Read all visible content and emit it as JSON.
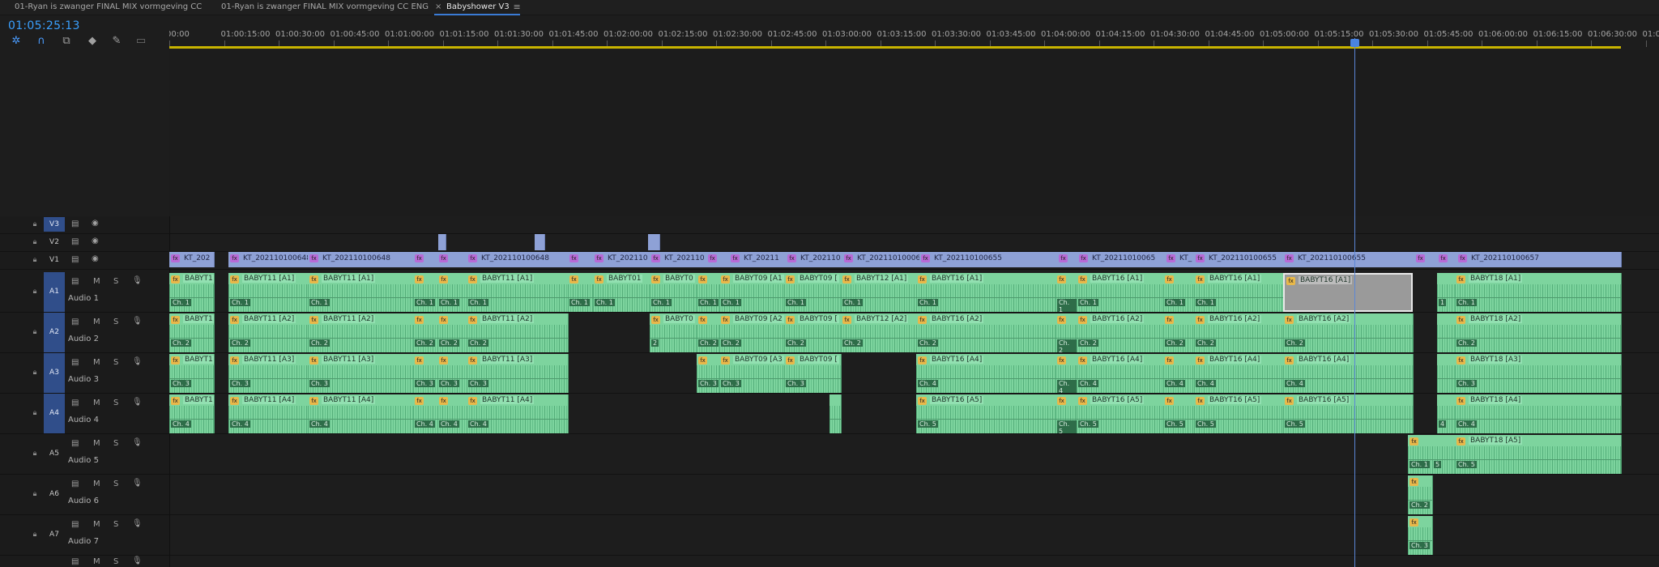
{
  "tabs": [
    {
      "label": "01-Ryan is zwanger FINAL MIX vormgeving CC",
      "active": false
    },
    {
      "label": "01-Ryan is zwanger FINAL MIX vormgeving CC ENG",
      "active": false
    },
    {
      "label": "Babyshower V3",
      "active": true,
      "close": "×",
      "menu": "≡"
    }
  ],
  "timecode": "01:05:25:13",
  "toolbar_icons": [
    "snap-icon",
    "magnet-icon",
    "linked-selection-icon",
    "marker-icon",
    "wrench-icon",
    "captions-icon"
  ],
  "ruler_labels": [
    "00:00",
    "01:00:15:00",
    "01:00:30:00",
    "01:00:45:00",
    "01:01:00:00",
    "01:01:15:00",
    "01:01:30:00",
    "01:01:45:00",
    "01:02:00:00",
    "01:02:15:00",
    "01:02:30:00",
    "01:02:45:00",
    "01:03:00:00",
    "01:03:15:00",
    "01:03:30:00",
    "01:03:45:00",
    "01:04:00:00",
    "01:04:15:00",
    "01:04:30:00",
    "01:04:45:00",
    "01:05:00:00",
    "01:05:15:00",
    "01:05:30:00",
    "01:05:45:00",
    "01:06:00:00",
    "01:06:15:00",
    "01:06:30:00",
    "01:06:45:00"
  ],
  "video_tracks": [
    {
      "label": "V3",
      "highlight": true
    },
    {
      "label": "V2",
      "highlight": false
    },
    {
      "label": "V1",
      "highlight": false
    }
  ],
  "audio_tracks": [
    {
      "label": "A1",
      "name": "Audio 1",
      "highlight": true,
      "m": "M",
      "s": "S"
    },
    {
      "label": "A2",
      "name": "Audio 2",
      "highlight": true,
      "m": "M",
      "s": "S"
    },
    {
      "label": "A3",
      "name": "Audio 3",
      "highlight": true,
      "m": "M",
      "s": "S"
    },
    {
      "label": "A4",
      "name": "Audio 4",
      "highlight": true,
      "m": "M",
      "s": "S"
    },
    {
      "label": "A5",
      "name": "Audio 5",
      "highlight": false,
      "m": "M",
      "s": "S"
    },
    {
      "label": "A6",
      "name": "Audio 6",
      "highlight": false,
      "m": "M",
      "s": "S"
    },
    {
      "label": "A7",
      "name": "Audio 7",
      "highlight": false,
      "m": "M",
      "s": "S"
    }
  ],
  "v1_clip_names": [
    "KT_202",
    "KT_202110100648",
    "KT_202110100648",
    "KT_202110100648",
    "KT_202110",
    "KT_202110",
    "KT_20211",
    "KT_202110",
    "KT_202110100064",
    "KT_202110100655",
    "KT_20211010065",
    "KT_",
    "KT_202110100655",
    "KT_202110100655",
    "KT_202110100657"
  ],
  "audio_clip_names": {
    "a1": [
      "BABYT1",
      "BABYT11 [A1]",
      "BABYT11 [A1]",
      "BABYT11 [A1]",
      "BABYT01",
      "BABYT0",
      "BABYT09 [A1",
      "BABYT09 [",
      "BABYT12 [A1]",
      "BABYT16 [A1]",
      "BABYT16 [A1]",
      "BABYT16 [A1]",
      "BABYT16 [A1]",
      "BABYT18 [A1]"
    ],
    "a2": [
      "BABYT1",
      "BABYT11 [A2]",
      "BABYT11 [A2]",
      "BABYT11 [A2]",
      "BABYT0",
      "BABYT09 [A2",
      "BABYT09 [",
      "BABYT12 [A2]",
      "BABYT16 [A2]",
      "BABYT16 [A2]",
      "BABYT16 [A2]",
      "BABYT16 [A2]",
      "BABYT18 [A2]"
    ],
    "a3": [
      "BABYT1",
      "BABYT11 [A3]",
      "BABYT11 [A3]",
      "BABYT11 [A3]",
      "BABYT09 [A3",
      "BABYT09 [",
      "BABYT16 [A4]",
      "BABYT16 [A4]",
      "BABYT16 [A4]",
      "BABYT16 [A4]",
      "BABYT18 [A3]"
    ],
    "a4": [
      "BABYT1",
      "BABYT11 [A4]",
      "BABYT11 [A4]",
      "BABYT11 [A4]",
      "BABYT16 [A5]",
      "BABYT16 [A5]",
      "BABYT16 [A5]",
      "BABYT16 [A5]",
      "BABYT18 [A4]"
    ],
    "a5": [
      "BABYT18 [A5]"
    ]
  },
  "colors": {
    "video_clip": "#8ea1d6",
    "audio_clip": "#7dd49e",
    "playhead": "#4a84e0",
    "track_highlight": "#304e8a",
    "work_area": "#c8b400"
  }
}
